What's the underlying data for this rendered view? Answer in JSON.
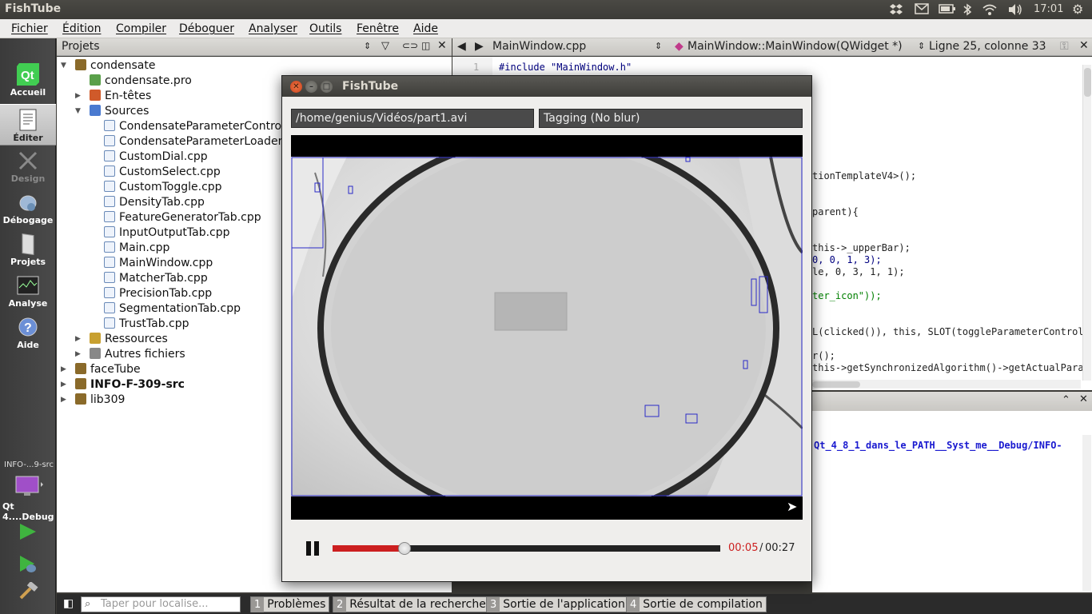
{
  "window_title": "FishTube",
  "topbar": {
    "app_title": "FishTube",
    "time": "17:01"
  },
  "menu": [
    "Fichier",
    "Édition",
    "Compiler",
    "Déboguer",
    "Analyser",
    "Outils",
    "Fenêtre",
    "Aide"
  ],
  "modes": [
    {
      "label": "Accueil",
      "icon": "qt-logo-icon"
    },
    {
      "label": "Éditer",
      "icon": "document-edit-icon"
    },
    {
      "label": "Design",
      "icon": "design-icon"
    },
    {
      "label": "Débogage",
      "icon": "bug-icon"
    },
    {
      "label": "Projets",
      "icon": "projects-icon"
    },
    {
      "label": "Analyse",
      "icon": "analyze-icon"
    },
    {
      "label": "Aide",
      "icon": "help-icon"
    }
  ],
  "kit": {
    "project": "INFO-...9-src",
    "config": "Qt 4....Debug"
  },
  "projects_pane": {
    "title": "Projets"
  },
  "tree": [
    {
      "label": "condensate",
      "level": 0,
      "arrow": "▼",
      "icon": "project",
      "bold": false
    },
    {
      "label": "condensate.pro",
      "level": 1,
      "arrow": "",
      "icon": "pro",
      "bold": false
    },
    {
      "label": "En-têtes",
      "level": 1,
      "arrow": "▶",
      "icon": "headers",
      "bold": false
    },
    {
      "label": "Sources",
      "level": 1,
      "arrow": "▼",
      "icon": "sources",
      "bold": false
    },
    {
      "label": "CondensateParameterControlW",
      "level": 2,
      "arrow": "",
      "icon": "cpp",
      "bold": false
    },
    {
      "label": "CondensateParameterLoader.c",
      "level": 2,
      "arrow": "",
      "icon": "cpp",
      "bold": false
    },
    {
      "label": "CustomDial.cpp",
      "level": 2,
      "arrow": "",
      "icon": "cpp",
      "bold": false
    },
    {
      "label": "CustomSelect.cpp",
      "level": 2,
      "arrow": "",
      "icon": "cpp",
      "bold": false
    },
    {
      "label": "CustomToggle.cpp",
      "level": 2,
      "arrow": "",
      "icon": "cpp",
      "bold": false
    },
    {
      "label": "DensityTab.cpp",
      "level": 2,
      "arrow": "",
      "icon": "cpp",
      "bold": false
    },
    {
      "label": "FeatureGeneratorTab.cpp",
      "level": 2,
      "arrow": "",
      "icon": "cpp",
      "bold": false
    },
    {
      "label": "InputOutputTab.cpp",
      "level": 2,
      "arrow": "",
      "icon": "cpp",
      "bold": false
    },
    {
      "label": "Main.cpp",
      "level": 2,
      "arrow": "",
      "icon": "cpp",
      "bold": false
    },
    {
      "label": "MainWindow.cpp",
      "level": 2,
      "arrow": "",
      "icon": "cpp",
      "bold": false
    },
    {
      "label": "MatcherTab.cpp",
      "level": 2,
      "arrow": "",
      "icon": "cpp",
      "bold": false
    },
    {
      "label": "PrecisionTab.cpp",
      "level": 2,
      "arrow": "",
      "icon": "cpp",
      "bold": false
    },
    {
      "label": "SegmentationTab.cpp",
      "level": 2,
      "arrow": "",
      "icon": "cpp",
      "bold": false
    },
    {
      "label": "TrustTab.cpp",
      "level": 2,
      "arrow": "",
      "icon": "cpp",
      "bold": false
    },
    {
      "label": "Ressources",
      "level": 1,
      "arrow": "▶",
      "icon": "resources",
      "bold": false
    },
    {
      "label": "Autres fichiers",
      "level": 1,
      "arrow": "▶",
      "icon": "other",
      "bold": false
    },
    {
      "label": "faceTube",
      "level": 0,
      "arrow": "▶",
      "icon": "project",
      "bold": false
    },
    {
      "label": "INFO-F-309-src",
      "level": 0,
      "arrow": "▶",
      "icon": "project",
      "bold": true
    },
    {
      "label": "lib309",
      "level": 0,
      "arrow": "▶",
      "icon": "project",
      "bold": false
    }
  ],
  "editor": {
    "file": "MainWindow.cpp",
    "symbol": "MainWindow::MainWindow(QWidget *)",
    "position": "Ligne 25, colonne 33",
    "line1_num": "1",
    "line1_code": "#include \"MainWindow.h\"",
    "visible_fragments": [
      "tionTemplateV4>();",
      "parent){",
      "this->_upperBar);",
      "0, 0, 1, 3);",
      "le, 0, 3, 1, 1);",
      "ter_icon\"));",
      "L(clicked()), this, SLOT(toggleParameterControl",
      "r();",
      "this->getSynchronizedAlgorithm()->getActualPara"
    ]
  },
  "output": {
    "line": "Qt_4_8_1_dans_le_PATH__Syst_me__Debug/INFO-"
  },
  "statusbar": {
    "locator_placeholder": "Taper pour localise...",
    "tabs": [
      {
        "num": "1",
        "label": "Problèmes"
      },
      {
        "num": "2",
        "label": "Résultat de la recherche"
      },
      {
        "num": "3",
        "label": "Sortie de l'application"
      },
      {
        "num": "4",
        "label": "Sortie de compilation"
      }
    ]
  },
  "dialog": {
    "title": "FishTube",
    "file_path": "/home/genius/Vidéos/part1.avi",
    "mode": "Tagging (No blur)",
    "current_time": "00:05",
    "separator": "/",
    "total_time": "00:27",
    "progress": 0.185,
    "accent": "#cc1f1f"
  }
}
